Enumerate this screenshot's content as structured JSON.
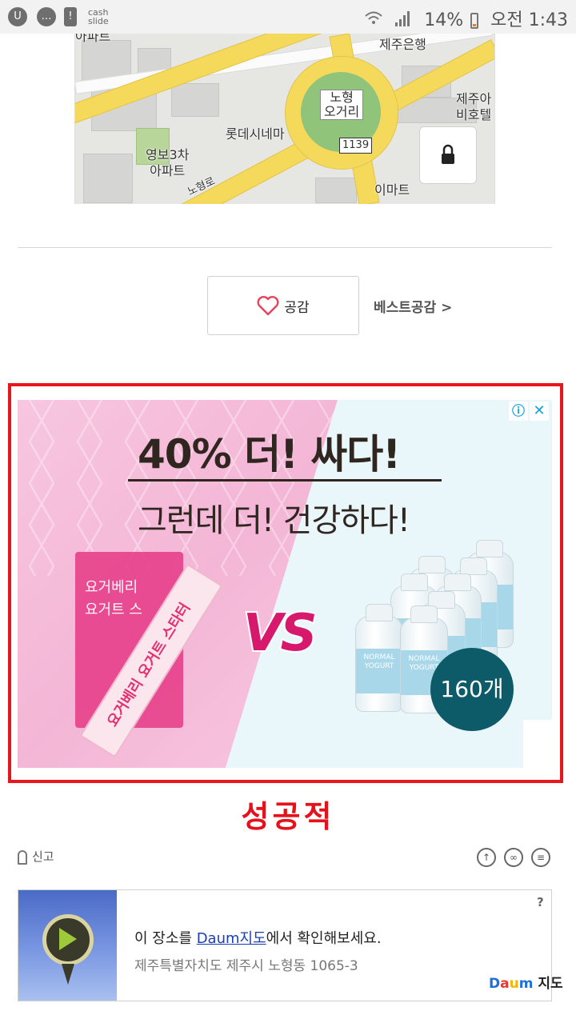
{
  "status_bar": {
    "left_icons": [
      "u-plus-icon",
      "chat-bubble-icon",
      "alert-icon"
    ],
    "cash_slide_line1": "cash",
    "cash_slide_line2": "slide",
    "battery": "14%",
    "time": "오전 1:43"
  },
  "map": {
    "labels": {
      "top_left": "아파트",
      "bank": "제주은행",
      "intersection_line1": "노형",
      "intersection_line2": "오거리",
      "cinema": "롯데시네마",
      "road_number": "1139",
      "apartment_line1": "영보3차",
      "apartment_line2": "아파트",
      "hotel_line1": "제주아",
      "hotel_line2": "비호텔",
      "mart": "이마트",
      "road_name": "노형로"
    },
    "lock_icon": "lock-icon"
  },
  "like": {
    "label": "공감",
    "icon": "heart-outline-icon",
    "best_link": "베스트공감 >"
  },
  "ad": {
    "headline": "40% 더! 싸다!",
    "subline": "그런데 더! 건강하다!",
    "vs": "VS",
    "box_text_1": "요거베리",
    "box_text_2": "요거트 스",
    "stick_text": "요거베리 요거트 스타터",
    "bottle_text": "NORMAL YOGURT",
    "count_badge": "160개",
    "info_icon": "info-icon",
    "close_icon": "close-icon",
    "accent_color": "#e8151b"
  },
  "caption": "성공적",
  "footer": {
    "report_label": "신고",
    "share_icons": [
      "share-icon",
      "link-icon",
      "more-icon"
    ]
  },
  "map_card": {
    "line1_prefix": "이 장소를 ",
    "line1_link": "Daum지도",
    "line1_suffix": "에서 확인해보세요.",
    "address": "제주특별자치도 제주시 노형동 1065-3",
    "help": "?",
    "brand": "지도"
  }
}
